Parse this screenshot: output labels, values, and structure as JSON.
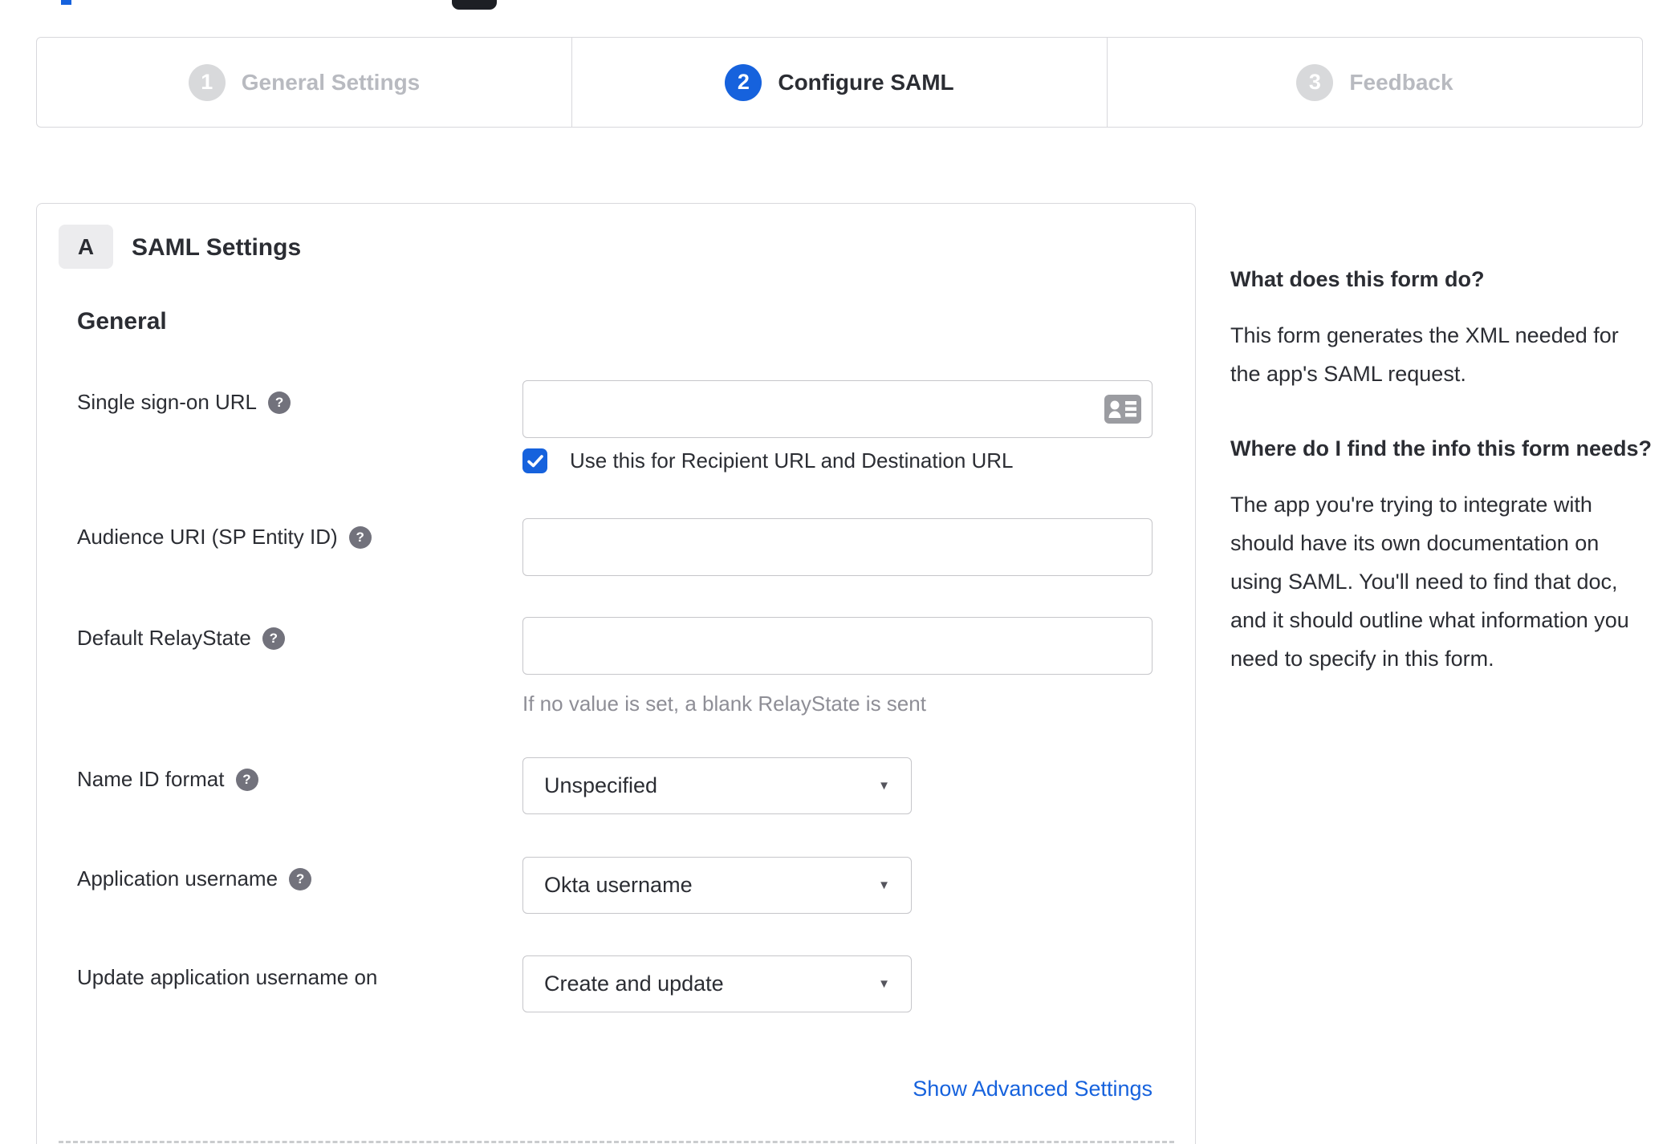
{
  "stepper": {
    "steps": [
      {
        "number": "1",
        "label": "General Settings",
        "state": "inactive"
      },
      {
        "number": "2",
        "label": "Configure SAML",
        "state": "active"
      },
      {
        "number": "3",
        "label": "Feedback",
        "state": "inactive"
      }
    ]
  },
  "panel": {
    "badge": "A",
    "title": "SAML Settings",
    "section": "General",
    "sso": {
      "label": "Single sign-on URL",
      "value": "",
      "checkbox_label": "Use this for Recipient URL and Destination URL",
      "checked": true
    },
    "audience": {
      "label": "Audience URI (SP Entity ID)",
      "value": ""
    },
    "relay": {
      "label": "Default RelayState",
      "value": "",
      "hint": "If no value is set, a blank RelayState is sent"
    },
    "name_id": {
      "label": "Name ID format",
      "value": "Unspecified"
    },
    "app_username": {
      "label": "Application username",
      "value": "Okta username"
    },
    "update_username": {
      "label": "Update application username on",
      "value": "Create and update"
    },
    "advanced_link": "Show Advanced Settings"
  },
  "sidebar": {
    "q1": "What does this form do?",
    "a1": "This form generates the XML needed for the app's SAML request.",
    "q2": "Where do I find the info this form needs?",
    "a2": "The app you're trying to integrate with should have its own documentation on using SAML. You'll need to find that doc, and it should outline what information you need to specify in this form."
  },
  "icons": {
    "help": "?",
    "caret": "▼"
  },
  "colors": {
    "accent_blue": "#1662dd",
    "inactive_gray": "#d8d9db",
    "input_border": "#c6c6ca",
    "hint_gray": "#8e8e96"
  }
}
